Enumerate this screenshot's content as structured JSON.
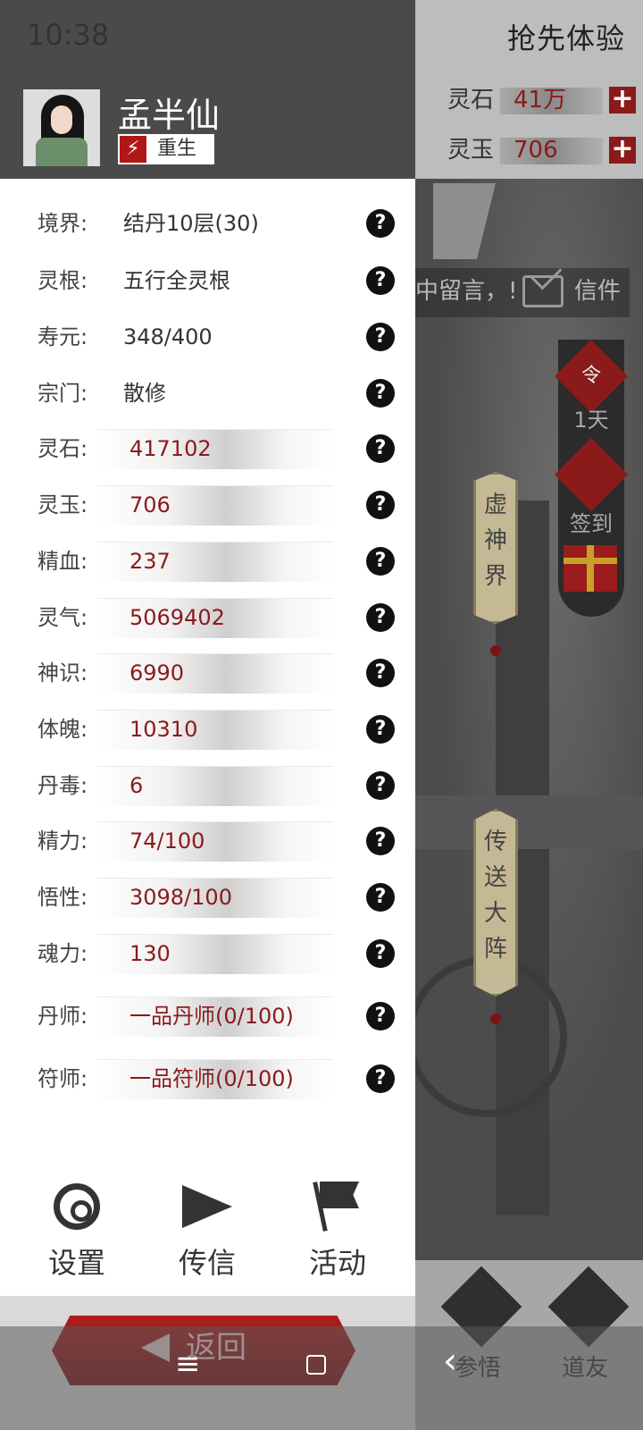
{
  "status_bar": {
    "time": "10:38"
  },
  "game": {
    "banner": "抢先体验",
    "resources": [
      {
        "label": "灵石",
        "value": "41万",
        "plus": "+"
      },
      {
        "label": "灵玉",
        "value": "706",
        "plus": "+"
      }
    ],
    "ticker": {
      "text": "中留言，!",
      "mail_label": "信件"
    },
    "side": {
      "order_icon": "令",
      "order_days": "1天",
      "checkin_label": "签到"
    },
    "places": [
      {
        "name": "虚神界"
      },
      {
        "name": "传送大阵"
      }
    ],
    "bottom_nav": [
      {
        "label": "参悟",
        "icon": "book-icon"
      },
      {
        "label": "道友",
        "icon": "handshake-icon"
      }
    ]
  },
  "profile": {
    "name": "孟半仙",
    "rebirth_label": "重生",
    "rebirth_icon": "⚡"
  },
  "stats": [
    {
      "key": "境界:",
      "value": "结丹10层(30)",
      "bar": false
    },
    {
      "key": "灵根:",
      "value": "五行全灵根",
      "bar": false
    },
    {
      "key": "寿元:",
      "value": "348/400",
      "bar": false
    },
    {
      "key": "宗门:",
      "value": "散修",
      "bar": false
    },
    {
      "key": "灵石:",
      "value": "417102",
      "bar": true
    },
    {
      "key": "灵玉:",
      "value": "706",
      "bar": true
    },
    {
      "key": "精血:",
      "value": "237",
      "bar": true
    },
    {
      "key": "灵气:",
      "value": "5069402",
      "bar": true
    },
    {
      "key": "神识:",
      "value": "6990",
      "bar": true
    },
    {
      "key": "体魄:",
      "value": "10310",
      "bar": true
    },
    {
      "key": "丹毒:",
      "value": "6",
      "bar": true
    },
    {
      "key": "精力:",
      "value": "74/100",
      "bar": true
    },
    {
      "key": "悟性:",
      "value": "3098/100",
      "bar": true
    },
    {
      "key": "魂力:",
      "value": "130",
      "bar": true
    },
    {
      "key": "丹师:",
      "value": "一品丹师(0/100)",
      "bar": true
    },
    {
      "key": "符师:",
      "value": "一品符师(0/100)",
      "bar": true
    }
  ],
  "help_glyph": "?",
  "drawer_menu": [
    {
      "label": "设置",
      "icon": "gear-icon"
    },
    {
      "label": "传信",
      "icon": "send-icon"
    },
    {
      "label": "活动",
      "icon": "flag-icon"
    }
  ],
  "back_button": {
    "label": "返回"
  },
  "system_nav": {
    "menu": "≡",
    "home": "",
    "back": "‹"
  },
  "colors": {
    "accent_red": "#8b1a1a",
    "header_dark": "#4a4a4a"
  }
}
